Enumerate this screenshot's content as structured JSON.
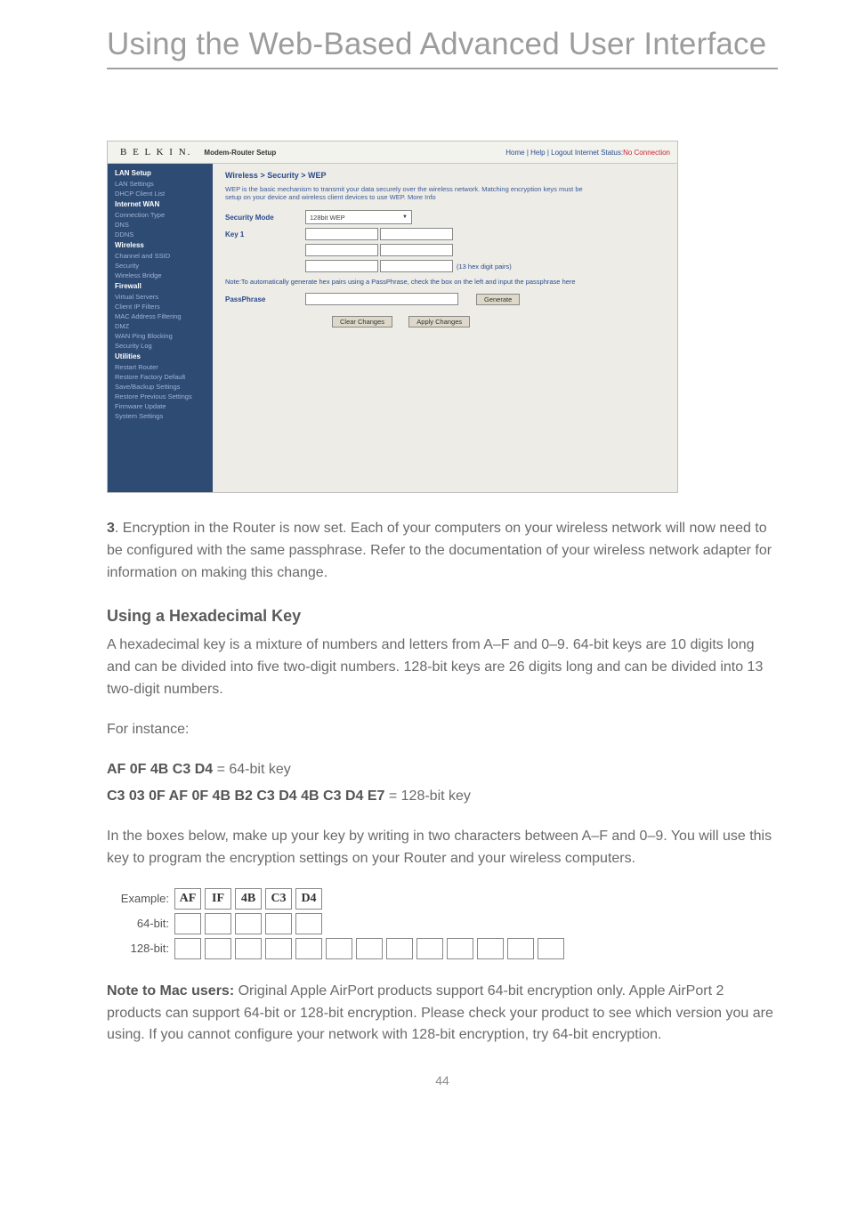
{
  "page": {
    "title": "Using the Web-Based Advanced User Interface",
    "number": "44"
  },
  "screenshot": {
    "logo": "B E L K I N.",
    "subtitle": "Modem-Router Setup",
    "links": "Home | Help | Logout   Internet Status:",
    "status": "No Connection",
    "nav": {
      "g1": "LAN Setup",
      "g1a": "LAN Settings",
      "g1b": "DHCP Client List",
      "g2": "Internet WAN",
      "g2a": "Connection Type",
      "g2b": "DNS",
      "g2c": "DDNS",
      "g3": "Wireless",
      "g3a": "Channel and SSID",
      "g3b": "Security",
      "g3c": "Wireless Bridge",
      "g4": "Firewall",
      "g4a": "Virtual Servers",
      "g4b": "Client IP Filters",
      "g4c": "MAC Address Filtering",
      "g4d": "DMZ",
      "g4e": "WAN Ping Blocking",
      "g4f": "Security Log",
      "g5": "Utilities",
      "g5a": "Restart Router",
      "g5b": "Restore Factory Default",
      "g5c": "Save/Backup Settings",
      "g5d": "Restore Previous Settings",
      "g5e": "Firmware Update",
      "g5f": "System Settings"
    },
    "main": {
      "crumb": "Wireless > Security > WEP",
      "desc": "WEP is the basic mechanism to transmit your data securely over the wireless network. Matching encryption keys must be setup on your device and wireless client devices to use WEP. ",
      "more": "More Info",
      "secmode_lbl": "Security Mode",
      "secmode_val": "128bit WEP",
      "key_lbl": "Key 1",
      "key_hint": "(13 hex digit pairs)",
      "note": "Note:To automatically generate hex pairs using a PassPhrase, check the box on the left and input the passphrase here",
      "pp_lbl": "PassPhrase",
      "gen_btn": "Generate",
      "clear_btn": "Clear Changes",
      "apply_btn": "Apply Changes"
    }
  },
  "body": {
    "step3": ". Encryption in the Router is now set. Each of your computers on your wireless network will now need to be configured with the same passphrase. Refer to the documentation of your wireless network adapter for information on making this change.",
    "step3_num": "3",
    "hex_hdr": "Using a Hexadecimal Key",
    "hex_p1": "A hexadecimal key is a mixture of numbers and letters from A–F and 0–9. 64-bit keys are 10 digits long and can be divided into five two-digit numbers. 128-bit keys are 26 digits long and can be divided into 13 two-digit numbers.",
    "hex_p2": "For instance:",
    "k64_key": "AF 0F 4B C3 D4",
    "k64_tail": " = 64-bit key",
    "k128_key": "C3 03 0F AF 0F 4B B2 C3 D4 4B C3 D4 E7",
    "k128_tail": " = 128-bit key",
    "inst": "In the boxes below, make up your key by writing in two characters between A–F and 0–9. You will use this key to program the encryption settings on your Router and your wireless computers.",
    "example_lbl": "Example:",
    "k64_lbl": "64-bit:",
    "k128_lbl": "128-bit:",
    "example_cells": [
      "AF",
      "IF",
      "4B",
      "C3",
      "D4"
    ],
    "mac_bold": "Note to Mac users:",
    "mac_body": " Original Apple AirPort products support 64-bit encryption only. Apple AirPort 2 products can support 64-bit or 128-bit encryption. Please check your product to see which version you are using. If you cannot configure your network with 128-bit encryption, try 64-bit encryption."
  }
}
